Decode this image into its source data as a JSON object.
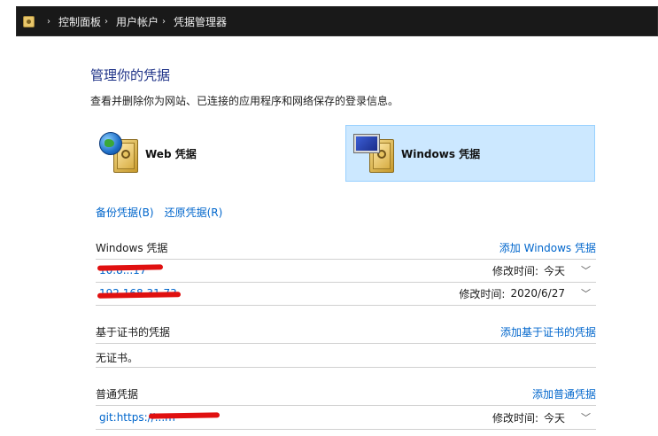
{
  "breadcrumb": [
    "控制面板",
    "用户帐户",
    "凭据管理器"
  ],
  "page": {
    "title": "管理你的凭据",
    "description": "查看并删除你为网站、已连接的应用程序和网络保存的登录信息。"
  },
  "cred_types": {
    "web_label": "Web 凭据",
    "windows_label": "Windows 凭据"
  },
  "links": {
    "backup": "备份凭据(B)",
    "restore": "还原凭据(R)"
  },
  "sections": {
    "windows": {
      "title": "Windows 凭据",
      "add": "添加 Windows 凭据",
      "items": [
        {
          "name": "10.8...17",
          "modified_label": "修改时间:",
          "modified": "今天"
        },
        {
          "name": "192.168.31.73",
          "modified_label": "修改时间:",
          "modified": "2020/6/27"
        }
      ]
    },
    "certificate": {
      "title": "基于证书的凭据",
      "add": "添加基于证书的凭据",
      "empty": "无证书。"
    },
    "generic": {
      "title": "普通凭据",
      "add": "添加普通凭据",
      "items": [
        {
          "name": "git:https://...m",
          "modified_label": "修改时间:",
          "modified": "今天"
        }
      ]
    }
  },
  "colors": {
    "accent_link": "#0066cc",
    "title": "#1e3287",
    "selected_bg": "#cce8ff",
    "redaction": "#e01010"
  }
}
